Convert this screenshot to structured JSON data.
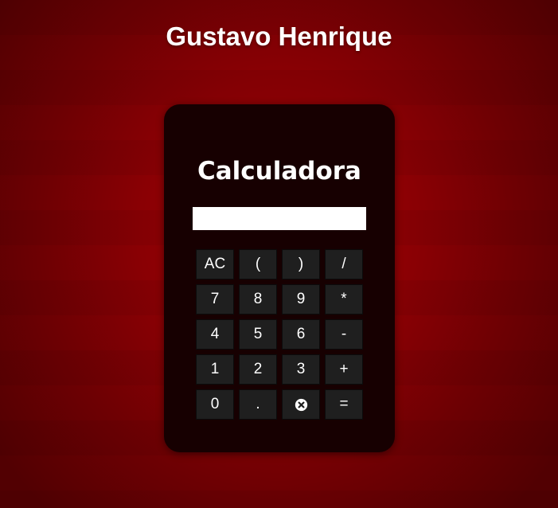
{
  "header": {
    "title": "Gustavo Henrique"
  },
  "calculator": {
    "title": "Calculadora",
    "display_value": "",
    "keys": [
      {
        "name": "clear-all-button",
        "label": "AC"
      },
      {
        "name": "open-paren-button",
        "label": "("
      },
      {
        "name": "close-paren-button",
        "label": ")"
      },
      {
        "name": "divide-button",
        "label": "/"
      },
      {
        "name": "digit-7-button",
        "label": "7"
      },
      {
        "name": "digit-8-button",
        "label": "8"
      },
      {
        "name": "digit-9-button",
        "label": "9"
      },
      {
        "name": "multiply-button",
        "label": "*"
      },
      {
        "name": "digit-4-button",
        "label": "4"
      },
      {
        "name": "digit-5-button",
        "label": "5"
      },
      {
        "name": "digit-6-button",
        "label": "6"
      },
      {
        "name": "subtract-button",
        "label": "-"
      },
      {
        "name": "digit-1-button",
        "label": "1"
      },
      {
        "name": "digit-2-button",
        "label": "2"
      },
      {
        "name": "digit-3-button",
        "label": "3"
      },
      {
        "name": "add-button",
        "label": "+"
      },
      {
        "name": "digit-0-button",
        "label": "0"
      },
      {
        "name": "decimal-button",
        "label": "."
      },
      {
        "name": "backspace-button",
        "icon": "clear-circle-icon"
      },
      {
        "name": "equals-button",
        "label": "="
      }
    ]
  },
  "colors": {
    "background_center": "#a50003",
    "background_edge": "#520002",
    "calculator_body": "#170001",
    "key_background": "#1f1f1f",
    "text": "#ffffff"
  }
}
